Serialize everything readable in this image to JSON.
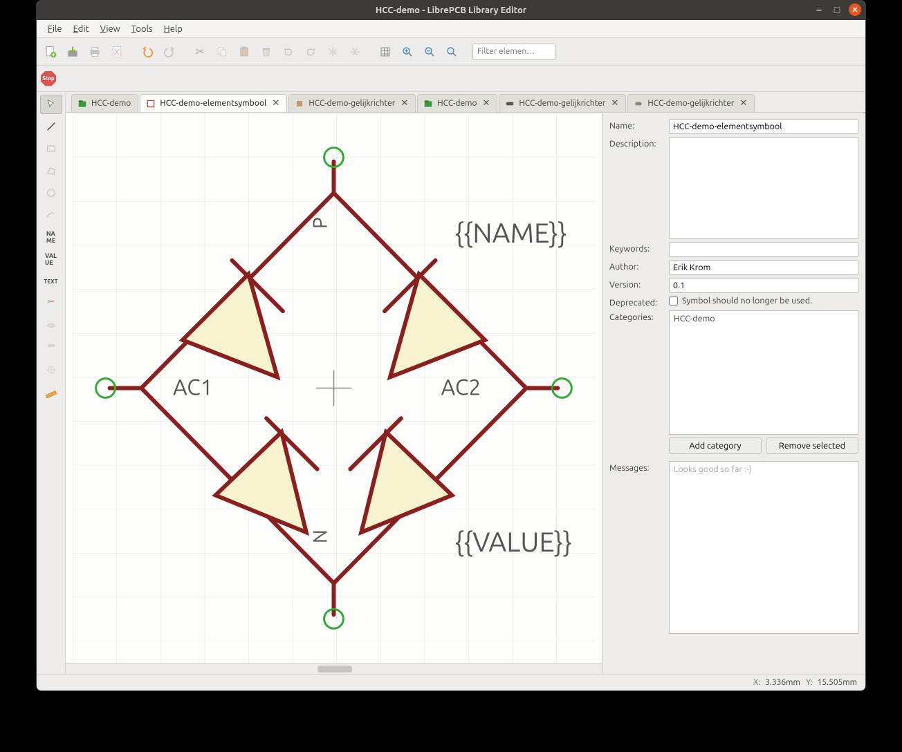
{
  "window_title": "HCC-demo - LibrePCB Library Editor",
  "menu": [
    "File",
    "Edit",
    "View",
    "Tools",
    "Help"
  ],
  "filter_placeholder": "Filter elemen…",
  "stop_label": "Stop",
  "tabs": [
    {
      "label": "HCC-demo",
      "icon": "library",
      "closable": false
    },
    {
      "label": "HCC-demo-elementsymbool",
      "icon": "symbol",
      "closable": true,
      "active": true
    },
    {
      "label": "HCC-demo-gelijkrichter",
      "icon": "component",
      "closable": true
    },
    {
      "label": "HCC-demo",
      "icon": "library",
      "closable": true
    },
    {
      "label": "HCC-demo-gelijkrichter",
      "icon": "footprint",
      "closable": true
    },
    {
      "label": "HCC-demo-gelijkrichter",
      "icon": "device",
      "closable": true
    }
  ],
  "canvas": {
    "name_placeholder": "{{NAME}}",
    "value_placeholder": "{{VALUE}}",
    "pin_labels": {
      "top": "P",
      "bottom": "N",
      "left": "AC1",
      "right": "AC2"
    }
  },
  "properties": {
    "name_label": "Name:",
    "name_value": "HCC-demo-elementsymbool",
    "description_label": "Description:",
    "description_value": "",
    "keywords_label": "Keywords:",
    "keywords_value": "",
    "author_label": "Author:",
    "author_value": "Erik Krom",
    "version_label": "Version:",
    "version_value": "0.1",
    "deprecated_label": "Deprecated:",
    "deprecated_text": "Symbol should no longer be used.",
    "categories_label": "Categories:",
    "categories_value": "HCC-demo",
    "add_category": "Add category",
    "remove_selected": "Remove selected",
    "messages_label": "Messages:",
    "messages_placeholder": "Looks good so far :-)"
  },
  "status": {
    "x_label": "X:",
    "x_value": "3.336mm",
    "y_label": "Y:",
    "y_value": "15.505mm"
  }
}
